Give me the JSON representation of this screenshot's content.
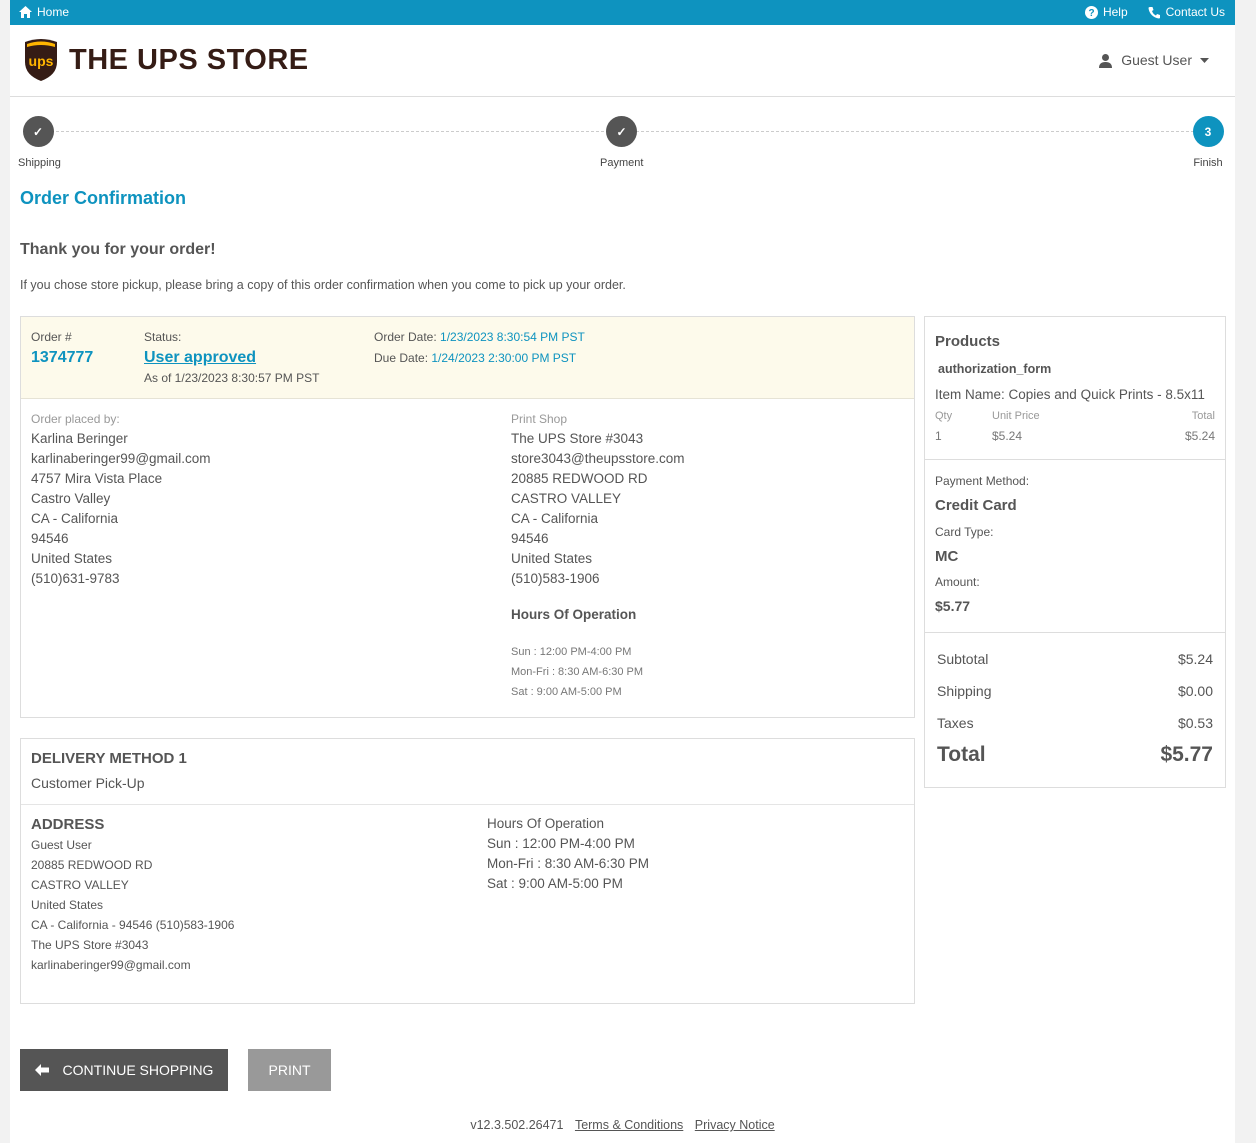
{
  "topbar": {
    "home": "Home",
    "help": "Help",
    "contact": "Contact Us"
  },
  "header": {
    "logo_badge": "ups",
    "logo_text": "THE UPS STORE",
    "user": "Guest User"
  },
  "steps": [
    {
      "label": "Shipping",
      "state": "done",
      "symbol": "✓"
    },
    {
      "label": "Payment",
      "state": "done",
      "symbol": "✓"
    },
    {
      "label": "Finish",
      "state": "current",
      "symbol": "3"
    }
  ],
  "page": {
    "title": "Order Confirmation",
    "thanks": "Thank you for your order!",
    "note": "If you chose store pickup, please bring a copy of this order confirmation when you come to pick up your order."
  },
  "order": {
    "number_label": "Order #",
    "number": "1374777",
    "status_label": "Status:",
    "status": "User approved",
    "status_asof": "As of 1/23/2023 8:30:57 PM PST",
    "order_date_label": "Order Date:",
    "order_date": "1/23/2023 8:30:54 PM PST",
    "due_date_label": "Due Date:",
    "due_date": "1/24/2023 2:30:00 PM PST"
  },
  "placed_by": {
    "label": "Order placed by:",
    "lines": [
      "Karlina Beringer",
      "karlinaberinger99@gmail.com",
      "4757 Mira Vista Place",
      "Castro Valley",
      "CA - California",
      "94546",
      "United States",
      "(510)631-9783"
    ]
  },
  "print_shop": {
    "label": "Print Shop",
    "lines": [
      "The UPS Store #3043",
      "store3043@theupsstore.com",
      "20885 REDWOOD RD",
      "CASTRO VALLEY",
      "CA - California",
      "94546",
      "United States",
      "(510)583-1906"
    ],
    "hours_title": "Hours Of Operation",
    "hours": [
      "Sun : 12:00 PM-4:00 PM",
      "Mon-Fri : 8:30 AM-6:30 PM",
      "Sat : 9:00 AM-5:00 PM"
    ]
  },
  "delivery": {
    "title": "DELIVERY METHOD 1",
    "method": "Customer Pick-Up",
    "address_title": "ADDRESS",
    "address_lines": [
      "Guest User",
      "20885 REDWOOD RD",
      "CASTRO VALLEY",
      "United States",
      "CA - California - 94546 (510)583-1906",
      "The UPS Store #3043",
      "karlinaberinger99@gmail.com"
    ],
    "hours_title": "Hours Of Operation",
    "hours": [
      "Sun : 12:00 PM-4:00 PM",
      "Mon-Fri : 8:30 AM-6:30 PM",
      "Sat : 9:00 AM-5:00 PM"
    ]
  },
  "summary": {
    "products_title": "Products",
    "form_name": "authorization_form",
    "item_name": "Item Name: Copies and Quick Prints - 8.5x11",
    "col_qty": "Qty",
    "col_unit": "Unit Price",
    "col_total": "Total",
    "qty": "1",
    "unit_price": "$5.24",
    "line_total": "$5.24",
    "payment_method_label": "Payment Method:",
    "payment_method": "Credit Card",
    "card_type_label": "Card Type:",
    "card_type": "MC",
    "amount_label": "Amount:",
    "amount": "$5.77",
    "subtotal_label": "Subtotal",
    "subtotal": "$5.24",
    "shipping_label": "Shipping",
    "shipping": "$0.00",
    "taxes_label": "Taxes",
    "taxes": "$0.53",
    "total_label": "Total",
    "total": "$5.77"
  },
  "buttons": {
    "continue": "CONTINUE SHOPPING",
    "print": "PRINT"
  },
  "footer": {
    "version": "v12.3.502.26471",
    "terms": "Terms & Conditions",
    "privacy": "Privacy Notice"
  },
  "colors": {
    "brand_blue": "#0e93bf",
    "step_done": "#555555",
    "brown": "#351c15",
    "gold": "#ffb500"
  }
}
